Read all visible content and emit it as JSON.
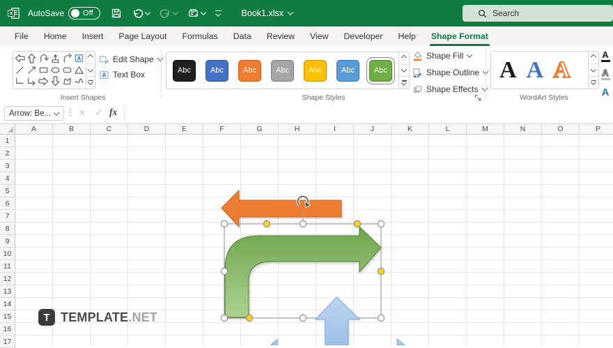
{
  "titlebar": {
    "autosave_label": "AutoSave",
    "autosave_state": "Off",
    "workbook_name": "Book1.xlsx",
    "search_placeholder": "Search",
    "accent_color": "#107C41"
  },
  "tabs": {
    "items": [
      "File",
      "Home",
      "Insert",
      "Page Layout",
      "Formulas",
      "Data",
      "Review",
      "View",
      "Developer",
      "Help",
      "Shape Format"
    ],
    "active": "Shape Format"
  },
  "ribbon": {
    "insert_shapes": {
      "group_label": "Insert Shapes",
      "edit_shape_label": "Edit Shape",
      "text_box_label": "Text Box",
      "gallery": [
        "block-arrow-left",
        "block-arrow-up",
        "curved-left-arrow",
        "up-arrow-callout",
        "bent-arrow",
        "text-box",
        "line",
        "line-arrow",
        "rectangle",
        "oval",
        "rounded-rectangle",
        "isosceles-triangle",
        "elbow-connector",
        "elbow-arrow-connector",
        "block-arrow-right",
        "block-arrow-down",
        "freeform",
        "scribble"
      ]
    },
    "shape_styles": {
      "group_label": "Shape Styles",
      "swatch_text": "Abc",
      "swatches": [
        {
          "name": "black",
          "fill": "#1f1f1f",
          "border": "#000000",
          "text": "#ffffff"
        },
        {
          "name": "blue",
          "fill": "#4472C4",
          "border": "#2F528F",
          "text": "#ffffff"
        },
        {
          "name": "orange",
          "fill": "#ED7D31",
          "border": "#C55A11",
          "text": "#ffffff"
        },
        {
          "name": "gray",
          "fill": "#A5A5A5",
          "border": "#7B7B7B",
          "text": "#ffffff"
        },
        {
          "name": "gold",
          "fill": "#FFC000",
          "border": "#BF9000",
          "text": "#ffffff"
        },
        {
          "name": "light-blue",
          "fill": "#5B9BD5",
          "border": "#2E75B6",
          "text": "#ffffff"
        },
        {
          "name": "green",
          "fill": "#70AD47",
          "border": "#538135",
          "text": "#ffffff"
        }
      ],
      "selected_index": 6
    },
    "shape_tools": {
      "fill_label": "Shape Fill",
      "outline_label": "Shape Outline",
      "effects_label": "Shape Effects"
    },
    "wordart": {
      "group_label": "WordArt Styles",
      "sample_letter": "A",
      "samples": [
        {
          "name": "black-fill",
          "color": "#1a1a1a"
        },
        {
          "name": "blue-fill",
          "color": "#4472C4"
        },
        {
          "name": "orange-outline",
          "color": "#ED7D31"
        }
      ],
      "side_buttons": [
        "text-fill",
        "text-outline",
        "text-effects"
      ]
    }
  },
  "formula_bar": {
    "name_box_value": "Arrow: Be...",
    "fx_label": "fx",
    "cancel_glyph": "×",
    "enter_glyph": "✓",
    "formula_value": ""
  },
  "grid": {
    "columns": [
      "A",
      "B",
      "C",
      "D",
      "E",
      "F",
      "G",
      "H",
      "I",
      "J",
      "K",
      "L",
      "M",
      "N",
      "O",
      "P"
    ],
    "rows": [
      "1",
      "2",
      "3",
      "4",
      "5",
      "6",
      "7",
      "8",
      "9",
      "10",
      "11",
      "12",
      "13",
      "14",
      "15",
      "16",
      "17"
    ]
  },
  "canvas": {
    "shapes": [
      {
        "name": "left-arrow",
        "fill": "#ED7D31",
        "stroke": "#CA6524"
      },
      {
        "name": "bent-arrow",
        "fill_top": "#6FA54D",
        "fill_bottom": "#ACD191",
        "stroke": "#538135",
        "selected": true
      },
      {
        "name": "up-arrow",
        "fill": "#A9C8EA",
        "stroke": "#84ABD6"
      }
    ],
    "selection": {
      "outline": "#8a8a8a",
      "handle_fill": "#ffffff",
      "adjust_handle_fill": "#FFD21F",
      "handle_stroke": "#8c8c8c"
    }
  },
  "watermark": {
    "logo_letter": "T",
    "brand_bold": "TEMPLATE",
    "brand_light": ".NET"
  }
}
